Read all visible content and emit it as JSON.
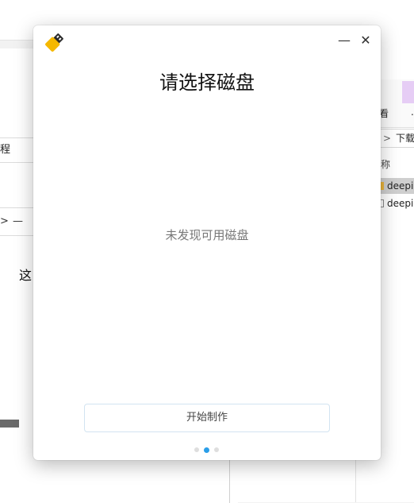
{
  "background_left": {
    "row_a_text": "程",
    "row_b_chevron": ">",
    "row_b_dash": "—",
    "big_text": "这"
  },
  "background_right": {
    "view_label": "看",
    "dot_mark": ".",
    "addr_chevron": ">",
    "addr_label": "下载",
    "column_header": "称",
    "files": [
      "deepi",
      "deepi"
    ]
  },
  "dialog": {
    "app_icon": "usb-drive-icon",
    "minimize_glyph": "—",
    "close_glyph": "✕",
    "title": "请选择磁盘",
    "empty_message": "未发现可用磁盘",
    "start_button_label": "开始制作",
    "pager": {
      "total": 3,
      "active": 2
    },
    "colors": {
      "accent": "#2a9ee8",
      "icon_yellow": "#f5b800",
      "icon_dark": "#2b2b2b"
    }
  }
}
